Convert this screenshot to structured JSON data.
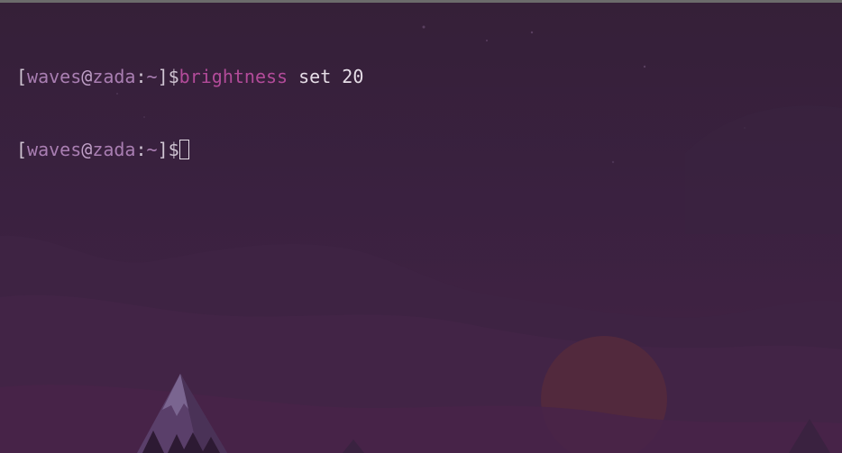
{
  "terminal": {
    "lines": [
      {
        "open_bracket": "[",
        "user": "waves",
        "at": "@",
        "host": "zada",
        "colon": ":",
        "cwd": "~",
        "close_bracket": "]",
        "dollar": "$",
        "command": "brightness",
        "args": " set 20"
      },
      {
        "open_bracket": "[",
        "user": "waves",
        "at": "@",
        "host": "zada",
        "colon": ":",
        "cwd": "~",
        "close_bracket": "]",
        "dollar": "$"
      }
    ]
  },
  "colors": {
    "background": "#3a2240",
    "prompt_user": "#a97eb2",
    "command": "#b34b9a",
    "text": "#e6dde7",
    "sun": "#5a2a3a"
  }
}
